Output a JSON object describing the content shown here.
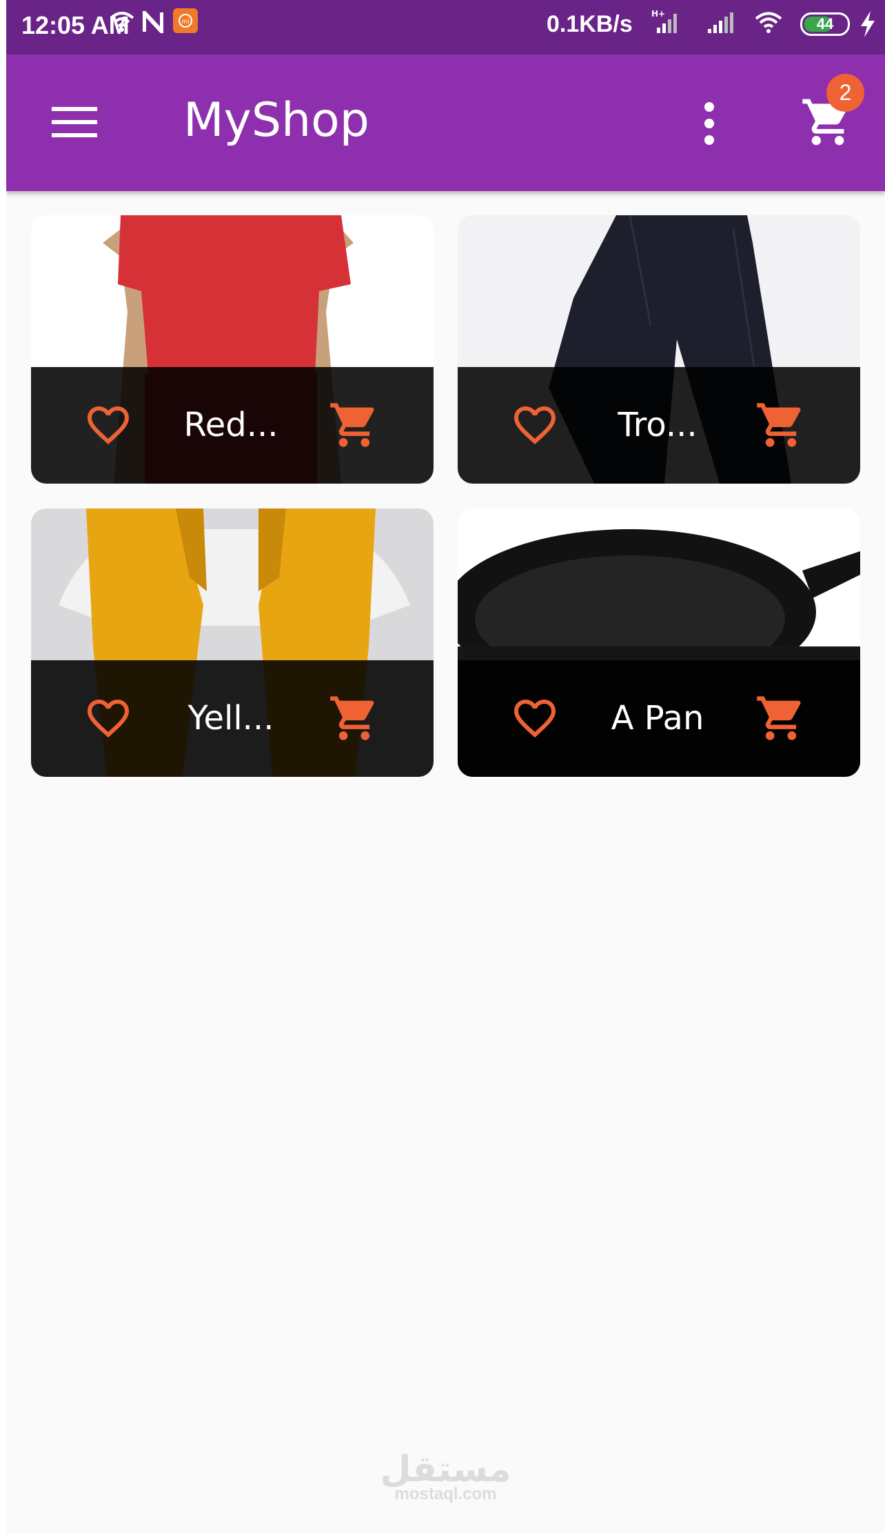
{
  "status_bar": {
    "time": "12:05 AM",
    "speed": "0.1KB/s",
    "network_type": "H+",
    "battery": "44",
    "icons": [
      "wifi-icon",
      "n-icon",
      "mi-app-icon",
      "signal-icon",
      "wifi-icon",
      "battery-icon",
      "charging-icon"
    ]
  },
  "app_bar": {
    "title": "MyShop",
    "cart_count": "2",
    "icons": [
      "menu-icon",
      "more-vert-icon",
      "shopping-cart-icon"
    ],
    "color": "#8e30ad"
  },
  "products": [
    {
      "title": "Red...",
      "image": "red-tshirt"
    },
    {
      "title": "Tro...",
      "image": "black-trousers"
    },
    {
      "title": "Yell...",
      "image": "yellow-scarf"
    },
    {
      "title": "A Pan",
      "image": "cast-iron-pan"
    }
  ],
  "colors": {
    "accent": "#ef6233",
    "primary": "#8e30ad",
    "status_bar": "#6a2488"
  },
  "watermark": {
    "arabic": "مستقل",
    "latin": "mostaql.com"
  }
}
